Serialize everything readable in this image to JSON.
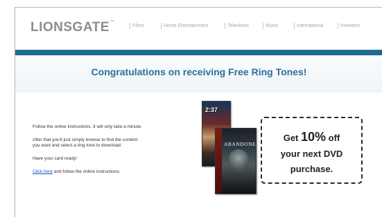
{
  "brand": {
    "logo_text": "LIONSGATE",
    "logo_tm": "™"
  },
  "nav": {
    "items": [
      {
        "label": "Films"
      },
      {
        "label": "Home Entertainment"
      },
      {
        "label": "Television"
      },
      {
        "label": "Music"
      },
      {
        "label": "International"
      },
      {
        "label": "Investors"
      }
    ]
  },
  "headline": "Congratulations on receiving Free Ring Tones!",
  "instructions": {
    "line1": "Follow the online instructions. It will only take a minute.",
    "line2a": "After that you'll just simply browse to find the content",
    "line2b": "you want and select a ring tone to download.",
    "line3": "Have your card ready!",
    "link_text": "Click here",
    "link_suffix": " and follow the online instructions."
  },
  "dvds": {
    "top_title": "2:37",
    "bottom_title": "ABANDONED"
  },
  "offer": {
    "pre": "Get ",
    "amount": "10%",
    "post": " off",
    "line2": "your next DVD",
    "line3": "purchase."
  },
  "colors": {
    "brand_blue": "#1f6a93",
    "headline_blue": "#2a6f9b",
    "link_blue": "#1a4fc4"
  }
}
